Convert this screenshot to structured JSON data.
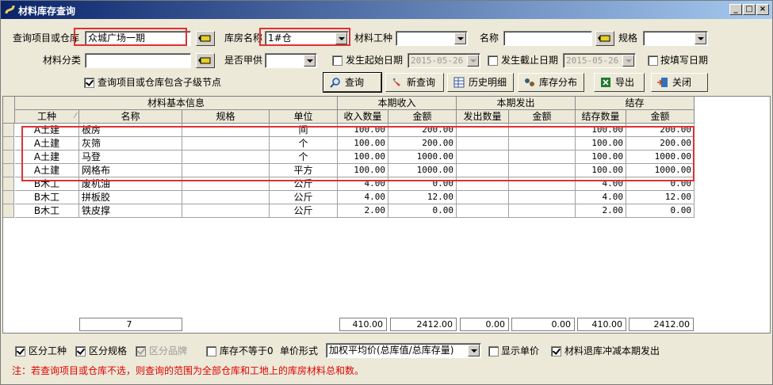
{
  "window": {
    "title": "材料库存查询",
    "min_label": "_",
    "max_label": "□",
    "close_label": "×"
  },
  "filters": {
    "query_item_label": "查询项目或仓库",
    "query_item_value": "众城广场一期",
    "warehouse_label": "库房名称",
    "warehouse_value": "1#仓",
    "trade_label": "材料工种",
    "trade_value": "",
    "name_label": "名称",
    "name_value": "",
    "spec_label": "规格",
    "spec_value": "",
    "category_label": "材料分类",
    "category_value": "",
    "owner_supply_label": "是否甲供",
    "owner_supply_value": "",
    "start_date_label": "发生起始日期",
    "start_date_value": "2015-05-26",
    "end_date_label": "发生截止日期",
    "end_date_value": "2015-05-26",
    "fill_date_label": "按填写日期",
    "include_children_label": "查询项目或仓库包含子级节点"
  },
  "toolbar": {
    "query_label": "查询",
    "new_query_label": "新查询",
    "history_label": "历史明细",
    "distribution_label": "库存分布",
    "export_label": "导出",
    "close_label": "关闭"
  },
  "grid": {
    "group_headers": [
      "材料基本信息",
      "本期收入",
      "本期发出",
      "结存"
    ],
    "columns": [
      "工种",
      "名称",
      "规格",
      "单位",
      "收入数量",
      "金额",
      "发出数量",
      "金额",
      "结存数量",
      "金额"
    ],
    "rows": [
      [
        "A土建",
        "板房",
        "",
        "间",
        "100.00",
        "200.00",
        "",
        "",
        "100.00",
        "200.00"
      ],
      [
        "A土建",
        "灰筛",
        "",
        "个",
        "100.00",
        "200.00",
        "",
        "",
        "100.00",
        "200.00"
      ],
      [
        "A土建",
        "马登",
        "",
        "个",
        "100.00",
        "1000.00",
        "",
        "",
        "100.00",
        "1000.00"
      ],
      [
        "A土建",
        "网格布",
        "",
        "平方",
        "100.00",
        "1000.00",
        "",
        "",
        "100.00",
        "1000.00"
      ],
      [
        "B木工",
        "废机油",
        "",
        "公斤",
        "4.00",
        "0.00",
        "",
        "",
        "4.00",
        "0.00"
      ],
      [
        "B木工",
        "拼板胶",
        "",
        "公斤",
        "4.00",
        "12.00",
        "",
        "",
        "4.00",
        "12.00"
      ],
      [
        "B木工",
        "铁皮撑",
        "",
        "公斤",
        "2.00",
        "0.00",
        "",
        "",
        "2.00",
        "0.00"
      ]
    ],
    "footer": {
      "count": "7",
      "in_qty": "410.00",
      "in_amt": "2412.00",
      "out_qty": "0.00",
      "out_amt": "0.00",
      "bal_qty": "410.00",
      "bal_amt": "2412.00"
    }
  },
  "options": {
    "by_trade_label": "区分工种",
    "by_spec_label": "区分规格",
    "by_brand_label": "区分品牌",
    "nonzero_label": "库存不等于0",
    "price_mode_label": "单价形式",
    "price_mode_value": "加权平均价(总库值/总库存量)",
    "show_price_label": "显示单价",
    "return_offset_label": "材料退库冲减本期发出"
  },
  "note": "注：若查询项目或仓库不选，则查询的范围为全部仓库和工地上的库房材料总和数。"
}
